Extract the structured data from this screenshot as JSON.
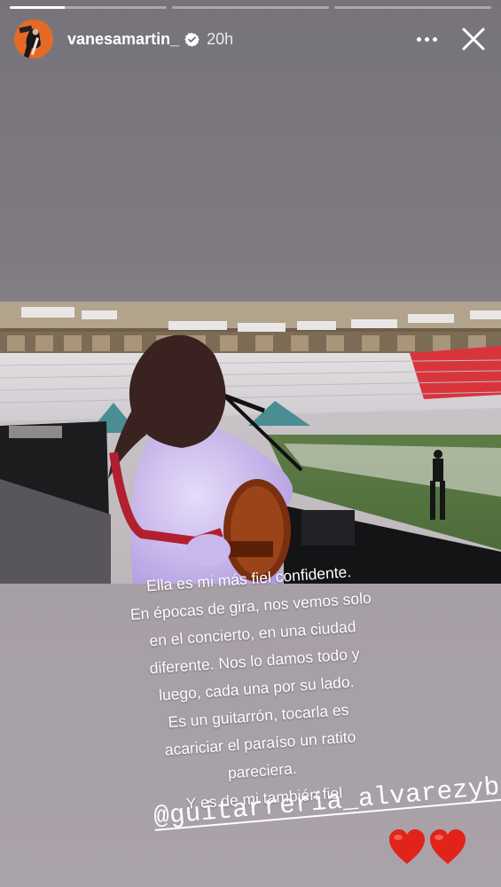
{
  "progress": {
    "segments": [
      1,
      0,
      0
    ],
    "active_fill": 0.35
  },
  "header": {
    "username": "vanesamartin_",
    "verified_icon": "verified-badge-icon",
    "time": "20h",
    "more_icon": "more-options-icon",
    "close_icon": "close-icon"
  },
  "photo": {
    "description_icon": "concert-stage-photo"
  },
  "caption": {
    "lines": [
      "Ella es mi más fiel confidente.",
      "En épocas de gira, nos vemos solo",
      "en el concierto, en una ciudad",
      "diferente. Nos lo damos todo y",
      "luego, cada una por su lado.",
      "Es un guitarrón, tocarla es",
      "acariciar el paraíso un ratito",
      "pareciera.",
      "Y es de mi también fiel"
    ]
  },
  "mention": {
    "text": "@guitarreria_alvarezybernal"
  },
  "stickers": {
    "hearts": [
      "heart-icon",
      "heart-icon"
    ]
  },
  "colors": {
    "heart": "#e2231a",
    "seats_red": "#d9343c",
    "shirt": "#c9b8ee"
  }
}
